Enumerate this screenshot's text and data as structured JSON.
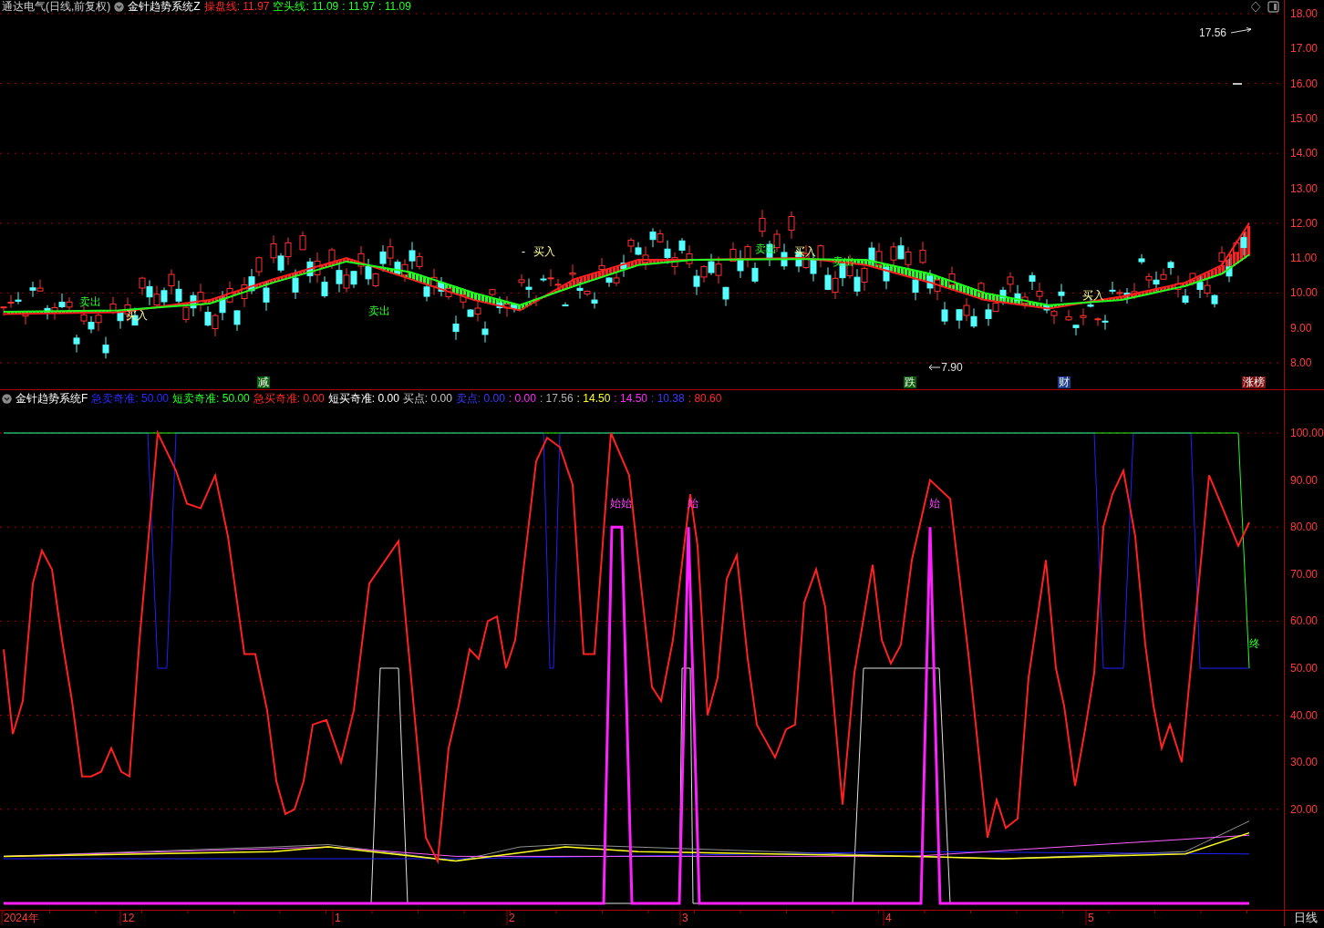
{
  "top_header": {
    "title": "通达电气(日线,前复权)",
    "indicator": "金针趋势系统Z",
    "items": [
      {
        "text": "操盘线: 11.97",
        "color": "#ff2828"
      },
      {
        "text": "空头线: 11.09",
        "color": "#28ff28"
      },
      {
        "text": ": 11.97",
        "color": "#28ff28"
      },
      {
        "text": ": 11.09",
        "color": "#28ff28"
      }
    ]
  },
  "price_chart": {
    "axis_labels": [
      "18.00",
      "17.00",
      "16.00",
      "15.00",
      "14.00",
      "13.00",
      "12.00",
      "11.00",
      "10.00",
      "9.00",
      "8.00"
    ],
    "signals": [
      {
        "text": "卖出",
        "kind": "sell"
      },
      {
        "text": "买入",
        "kind": "buy"
      },
      {
        "text": "卖出",
        "kind": "sell"
      },
      {
        "text": "-",
        "kind": "dash"
      },
      {
        "text": "买入",
        "kind": "buy"
      },
      {
        "text": "卖出",
        "kind": "sell"
      },
      {
        "text": "买入",
        "kind": "buy"
      },
      {
        "text": "卖出",
        "kind": "sell"
      },
      {
        "text": "买入",
        "kind": "buy"
      }
    ],
    "high_label": "17.56",
    "low_label": "7.90",
    "markers": [
      {
        "text": "减",
        "color": "#0b5e0b"
      },
      {
        "text": "跌",
        "color": "#0b5e0b"
      },
      {
        "text": "财",
        "color": "#1c3d8c"
      },
      {
        "text": "涨榜",
        "color": "#7a1010"
      }
    ]
  },
  "lower_header": {
    "indicator": "金针趋势系统F",
    "items": [
      {
        "text": "急卖奇准: 50.00",
        "color": "#2a2aff"
      },
      {
        "text": "短卖奇准: 50.00",
        "color": "#28ff28"
      },
      {
        "text": "急买奇准: 0.00",
        "color": "#ff2828"
      },
      {
        "text": "短买奇准: 0.00",
        "color": "#ffffff"
      },
      {
        "text": "买点: 0.00",
        "color": "#c8c8c8"
      },
      {
        "text": "卖点: 0.00",
        "color": "#3a3aff"
      },
      {
        "text": ": 0.00",
        "color": "#ff28ff"
      },
      {
        "text": ": 17.56",
        "color": "#b0b0b0"
      },
      {
        "text": ": 14.50",
        "color": "#ffff28"
      },
      {
        "text": ": 14.50",
        "color": "#ff28ff"
      },
      {
        "text": ": 10.38",
        "color": "#3a3aff"
      },
      {
        "text": ": 80.60",
        "color": "#ff2828"
      }
    ]
  },
  "indicator_chart": {
    "axis_labels": [
      "100.00",
      "90.00",
      "80.00",
      "70.00",
      "60.00",
      "50.00",
      "40.00",
      "30.00",
      "20.00"
    ],
    "signals": [
      {
        "text": "始始",
        "kind": "start"
      },
      {
        "text": "始",
        "kind": "start"
      },
      {
        "text": "始",
        "kind": "start"
      },
      {
        "text": "终",
        "kind": "end"
      }
    ]
  },
  "time_axis": [
    "2024年",
    "12",
    "1",
    "2",
    "3",
    "4",
    "5"
  ],
  "period_label": "日线"
}
